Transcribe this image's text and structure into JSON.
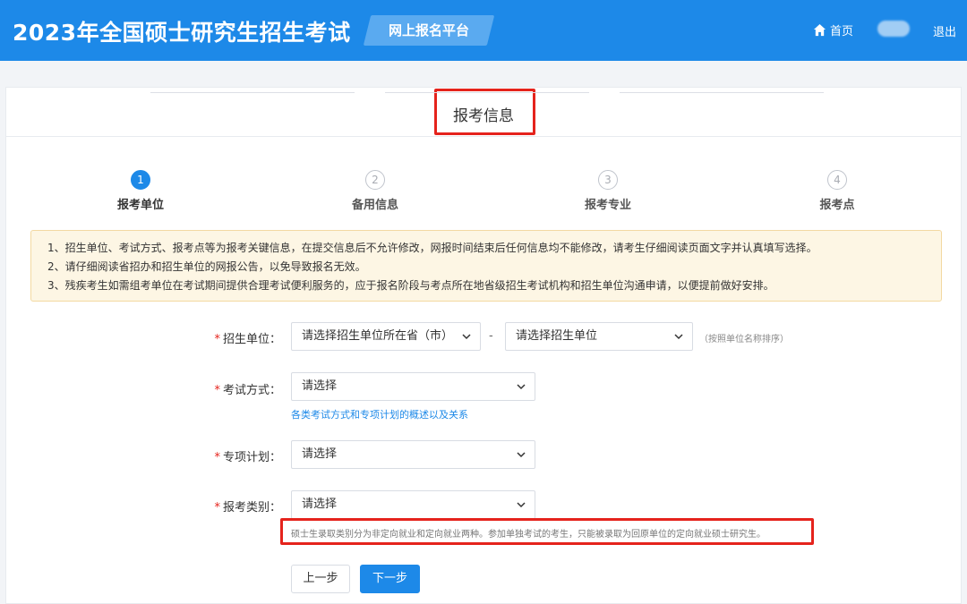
{
  "header": {
    "title": "2023年全国硕士研究生招生考试",
    "platform": "网上报名平台",
    "home": "首页",
    "logout": "退出"
  },
  "card": {
    "title": "报考信息"
  },
  "steps": [
    {
      "num": "1",
      "label": "报考单位",
      "active": true
    },
    {
      "num": "2",
      "label": "备用信息",
      "active": false
    },
    {
      "num": "3",
      "label": "报考专业",
      "active": false
    },
    {
      "num": "4",
      "label": "报考点",
      "active": false
    }
  ],
  "notice": [
    "1、招生单位、考试方式、报考点等为报考关键信息，在提交信息后不允许修改，网报时间结束后任何信息均不能修改，请考生仔细阅读页面文字并认真填写选择。",
    "2、请仔细阅读省招办和招生单位的网报公告，以免导致报名无效。",
    "3、残疾考生如需组考单位在考试期间提供合理考试便利服务的，应于报名阶段与考点所在地省级招生考试机构和招生单位沟通申请，以便提前做好安排。"
  ],
  "form": {
    "unit": {
      "label": "招生单位：",
      "province": "请选择招生单位所在省（市）",
      "dash": "-",
      "school": "请选择招生单位",
      "hint": "（按照单位名称排序）"
    },
    "exam_mode": {
      "label": "考试方式：",
      "value": "请选择",
      "link": "各类考试方式和专项计划的概述以及关系"
    },
    "special_plan": {
      "label": "专项计划：",
      "value": "请选择"
    },
    "category": {
      "label": "报考类别：",
      "value": "请选择",
      "tip": "硕士生录取类别分为非定向就业和定向就业两种。参加单独考试的考生，只能被录取为回原单位的定向就业硕士研究生。"
    }
  },
  "buttons": {
    "prev": "上一步",
    "next": "下一步"
  },
  "colors": {
    "brand": "#1d89e8",
    "highlight": "#e5231c",
    "notice_bg": "#fdf6e4"
  }
}
